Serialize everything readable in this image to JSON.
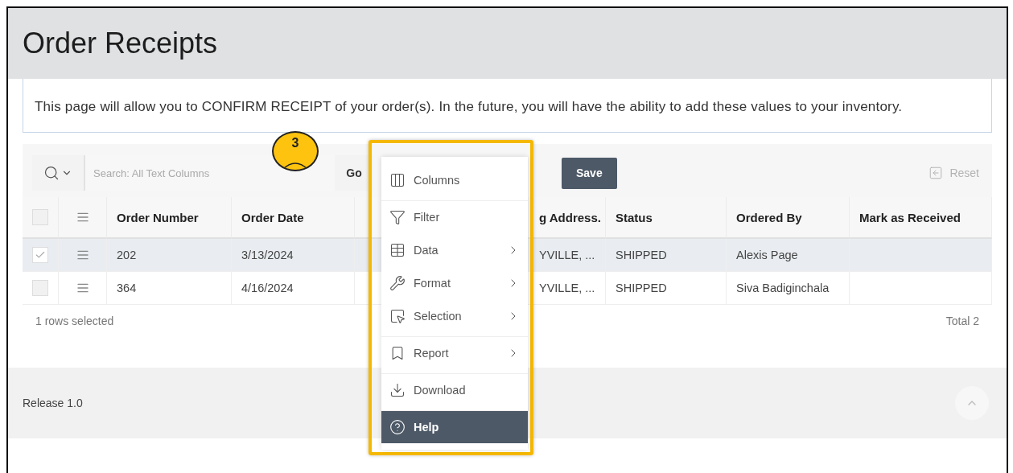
{
  "page": {
    "title": "Order Receipts"
  },
  "info": "This page will allow you to CONFIRM RECEIPT of your order(s). In the future, you will have the ability to add these values to your inventory.",
  "toolbar": {
    "search_placeholder": "Search: All Text Columns",
    "go": "Go",
    "save": "Save",
    "reset": "Reset"
  },
  "table": {
    "header_checked": false,
    "columns": [
      {
        "label": "Order Number",
        "covered": false
      },
      {
        "label": "Order Date",
        "covered": false
      },
      {
        "covered": true
      },
      {
        "label": "g Address.",
        "covered": false
      },
      {
        "label": "Status",
        "covered": false
      },
      {
        "label": "Ordered By",
        "covered": false
      },
      {
        "label": "Mark as Received",
        "covered": false
      }
    ],
    "rows": [
      {
        "selected": true,
        "checked": true,
        "cells": [
          "202",
          "3/13/2024",
          null,
          "YVILLE, ...",
          "SHIPPED",
          "Alexis Page",
          null
        ]
      },
      {
        "selected": false,
        "checked": false,
        "cells": [
          "364",
          "4/16/2024",
          null,
          "YVILLE, ...",
          "SHIPPED",
          "Siva Badiginchala",
          null
        ]
      }
    ]
  },
  "report_footer": {
    "selection": "1 rows selected",
    "total": "Total 2"
  },
  "page_footer": {
    "release": "Release 1.0"
  },
  "actions_menu": {
    "items": [
      {
        "label": "Columns",
        "submenu": false,
        "selected": false,
        "separator_before": false
      },
      {
        "label": "Filter",
        "submenu": false,
        "selected": false,
        "separator_before": true
      },
      {
        "label": "Data",
        "submenu": true,
        "selected": false,
        "separator_before": false
      },
      {
        "label": "Format",
        "submenu": true,
        "selected": false,
        "separator_before": false
      },
      {
        "label": "Selection",
        "submenu": true,
        "selected": false,
        "separator_before": false
      },
      {
        "label": "Report",
        "submenu": true,
        "selected": false,
        "separator_before": true
      },
      {
        "label": "Download",
        "submenu": false,
        "selected": false,
        "separator_before": true
      },
      {
        "label": "Help",
        "submenu": false,
        "selected": true,
        "separator_before": true
      }
    ]
  },
  "callout": {
    "number": "3"
  }
}
